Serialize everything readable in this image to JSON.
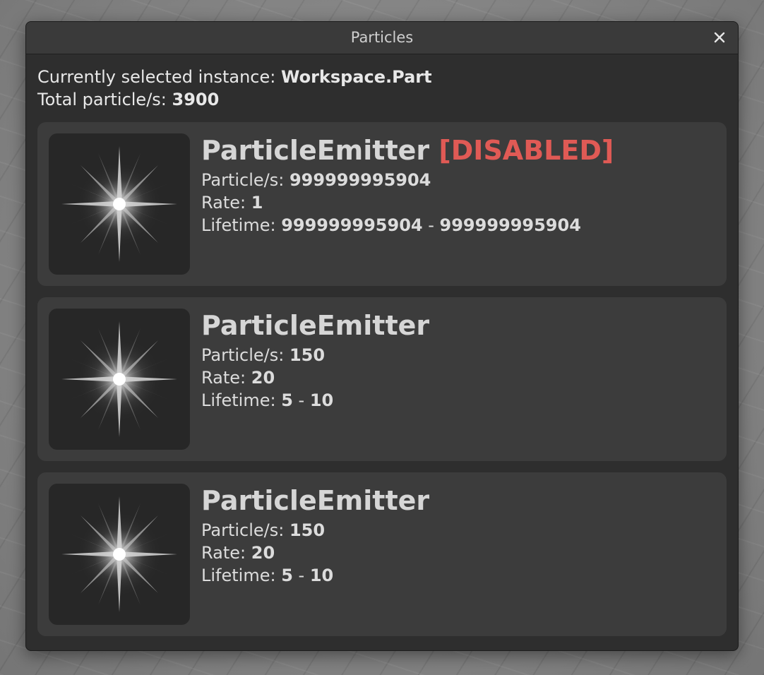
{
  "window": {
    "title": "Particles",
    "close_icon": "close-icon"
  },
  "summary": {
    "selected_label": "Currently selected instance: ",
    "selected_value": "Workspace.Part",
    "total_label": "Total particle/s: ",
    "total_value": "3900"
  },
  "emitters": [
    {
      "name": "ParticleEmitter",
      "status": "[DISABLED]",
      "particles_label": "Particle/s: ",
      "particles_value": "999999995904",
      "rate_label": "Rate: ",
      "rate_value": "1",
      "lifetime_label": "Lifetime: ",
      "lifetime_min": "999999995904",
      "lifetime_sep": " - ",
      "lifetime_max": "999999995904",
      "icon": "sparkle-icon"
    },
    {
      "name": "ParticleEmitter",
      "status": "",
      "particles_label": "Particle/s: ",
      "particles_value": "150",
      "rate_label": "Rate: ",
      "rate_value": "20",
      "lifetime_label": "Lifetime: ",
      "lifetime_min": "5",
      "lifetime_sep": " - ",
      "lifetime_max": "10",
      "icon": "sparkle-icon"
    },
    {
      "name": "ParticleEmitter",
      "status": "",
      "particles_label": "Particle/s: ",
      "particles_value": "150",
      "rate_label": "Rate: ",
      "rate_value": "20",
      "lifetime_label": "Lifetime: ",
      "lifetime_min": "5",
      "lifetime_sep": " - ",
      "lifetime_max": "10",
      "icon": "sparkle-icon"
    }
  ],
  "colors": {
    "disabled": "#e05a55",
    "window_bg": "#2e2e2e",
    "card_bg": "#3c3c3c"
  }
}
